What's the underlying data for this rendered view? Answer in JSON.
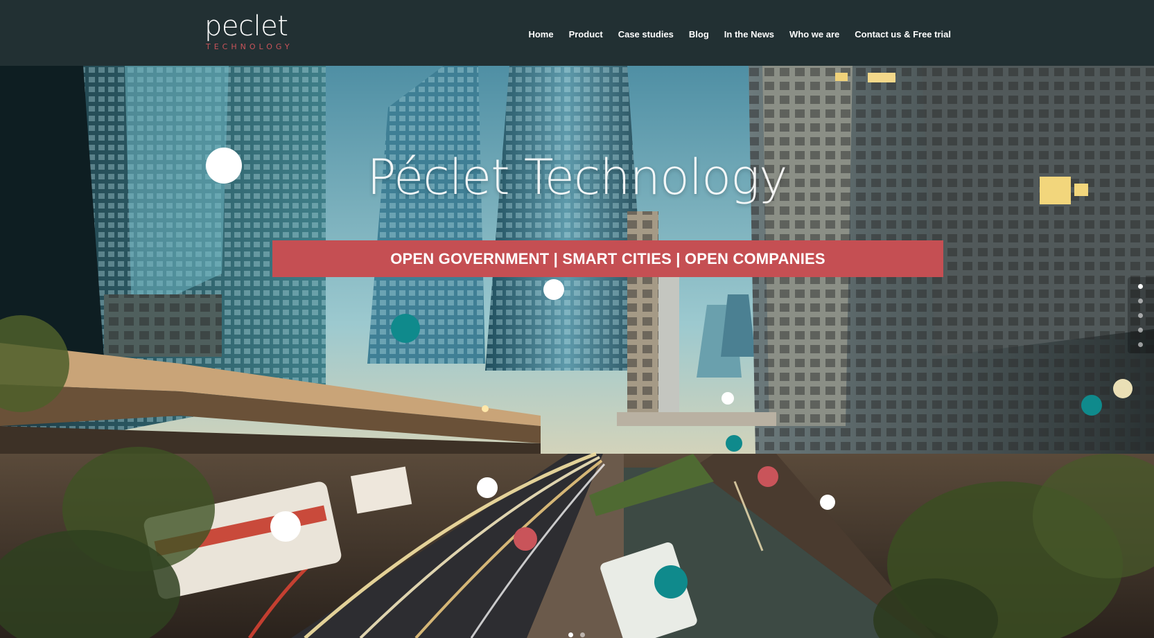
{
  "logo": {
    "main": "peclet",
    "sub": "TECHNOLOGY"
  },
  "nav": {
    "items": [
      {
        "label": "Home"
      },
      {
        "label": "Product"
      },
      {
        "label": "Case studies"
      },
      {
        "label": "Blog"
      },
      {
        "label": "In the News"
      },
      {
        "label": "Who we are"
      },
      {
        "label": "Contact us & Free trial"
      }
    ]
  },
  "hero": {
    "title": "Péclet Technology",
    "banner": "OPEN GOVERNMENT | SMART CITIES | OPEN COMPANIES",
    "background_icon": "city-skyline-photo"
  },
  "slider": {
    "side_dots_count": 5,
    "side_active_index": 0,
    "bottom_dots_count": 2,
    "bottom_active_index": 0
  },
  "colors": {
    "header_bg": "#223033",
    "accent_red": "#c54f53",
    "accent_teal": "#0f8a8c",
    "white": "#ffffff"
  }
}
